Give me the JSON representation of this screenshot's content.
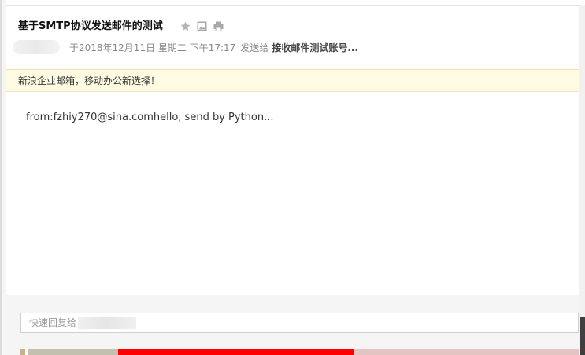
{
  "email": {
    "subject": "基于SMTP协议发送邮件的测试",
    "meta": {
      "sent_time": "于2018年12月11日 星期二 下午17:17",
      "sent_to_label": "发送给",
      "recipient": "接收邮件测试账号..."
    },
    "banner_text": "新浪企业邮箱，移动办公新选择！",
    "body_text": "from:fzhiy270@sina.comhello, send by Python...",
    "quick_reply_placeholder": "快速回复给"
  },
  "icons": {
    "star": "star-icon",
    "image": "image-icon",
    "print": "print-icon"
  },
  "colors": {
    "banner_bg": "#fffbe3",
    "ad_red": "#ff0000",
    "ad_pink": "#e8c8c8"
  }
}
